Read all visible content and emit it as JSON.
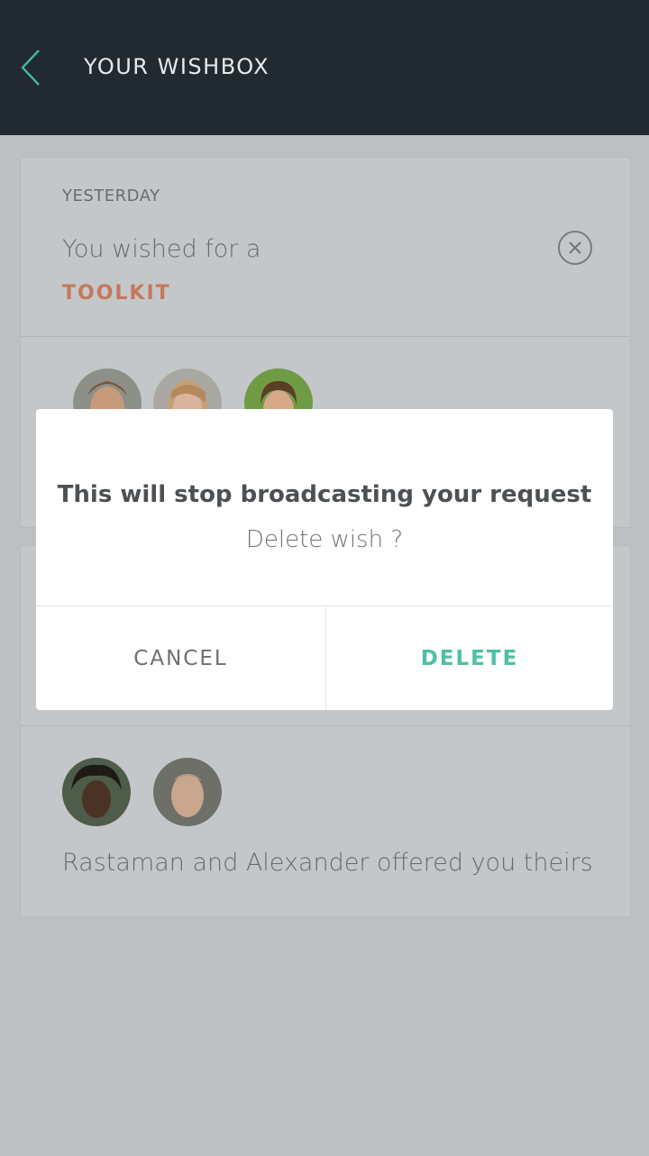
{
  "header": {
    "title": "YOUR WISHBOX"
  },
  "wish_card": {
    "date": "YESTERDAY",
    "text": "You wished for a",
    "item": "TOOLKIT"
  },
  "offer_card": {
    "text": "Rastaman and Alexander offered you theirs"
  },
  "dialog": {
    "title": "This will stop broadcasting your request",
    "subtitle": "Delete wish ?",
    "cancel_label": "CANCEL",
    "delete_label": "DELETE"
  },
  "colors": {
    "header_bg": "#222a31",
    "accent": "#4ec0a6",
    "item_accent": "#c6785a",
    "overlay_bg": "#bdc0c3"
  }
}
